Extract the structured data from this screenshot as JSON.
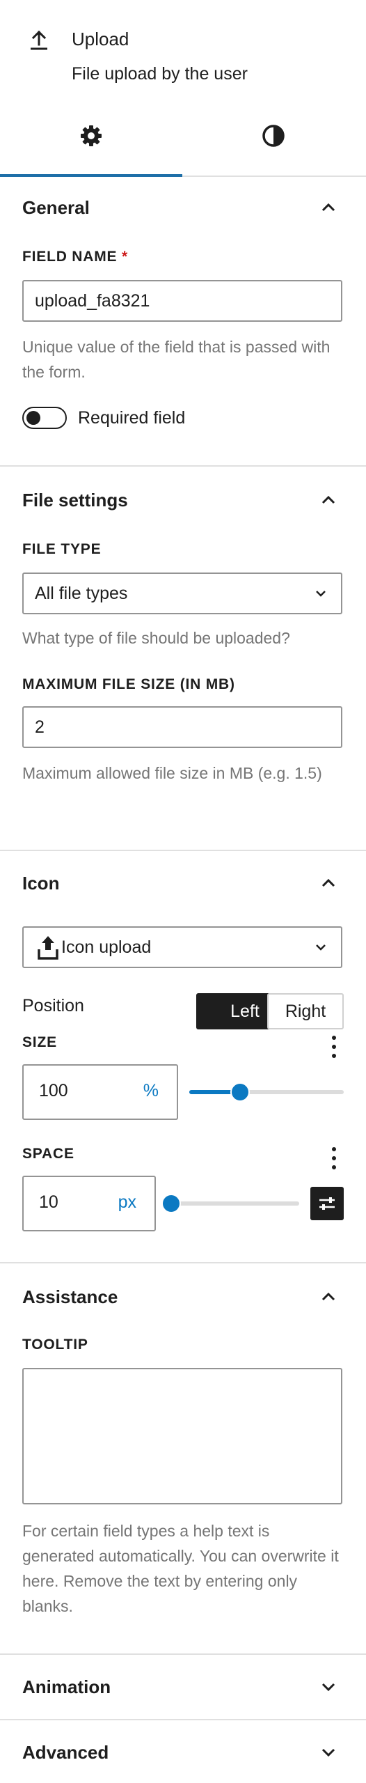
{
  "header": {
    "title": "Upload",
    "description": "File upload by the user",
    "icon": "upload-icon"
  },
  "tabs": [
    {
      "icon": "gear-icon",
      "active": true
    },
    {
      "icon": "contrast-icon",
      "active": false
    }
  ],
  "general": {
    "title": "General",
    "field_name_label": "FIELD NAME",
    "required_mark": "*",
    "field_name_value": "upload_fa8321",
    "field_name_help": "Unique value of the field that is passed with the form.",
    "required_toggle_label": "Required field",
    "required": false
  },
  "file_settings": {
    "title": "File settings",
    "file_type_label": "FILE TYPE",
    "file_type_value": "All file types",
    "file_type_help": "What type of file should be uploaded?",
    "max_size_label": "MAXIMUM FILE SIZE (IN MB)",
    "max_size_value": "2",
    "max_size_help": "Maximum allowed file size in MB (e.g. 1.5)"
  },
  "icon_panel": {
    "title": "Icon",
    "icon_select_value": "Icon upload",
    "position_label": "Position",
    "position_options": [
      "Left",
      "Right"
    ],
    "position_selected": "Left",
    "size_label": "SIZE",
    "size_value": "100",
    "size_unit": "%",
    "size_slider_fraction": 0.33,
    "space_label": "SPACE",
    "space_value": "10",
    "space_unit": "px",
    "space_slider_fraction": 0.0
  },
  "assistance": {
    "title": "Assistance",
    "tooltip_label": "TOOLTIP",
    "tooltip_value": "",
    "tooltip_help": "For certain field types a help text is generated automatically. You can overwrite it here. Remove the text by entering only blanks."
  },
  "animation": {
    "title": "Animation"
  },
  "advanced": {
    "title": "Advanced"
  },
  "colors": {
    "accent": "#0b79c2",
    "tab_indicator": "#1e6fa8",
    "required": "#cc1818",
    "muted_text": "#757575",
    "dark": "#1e1e1e"
  }
}
